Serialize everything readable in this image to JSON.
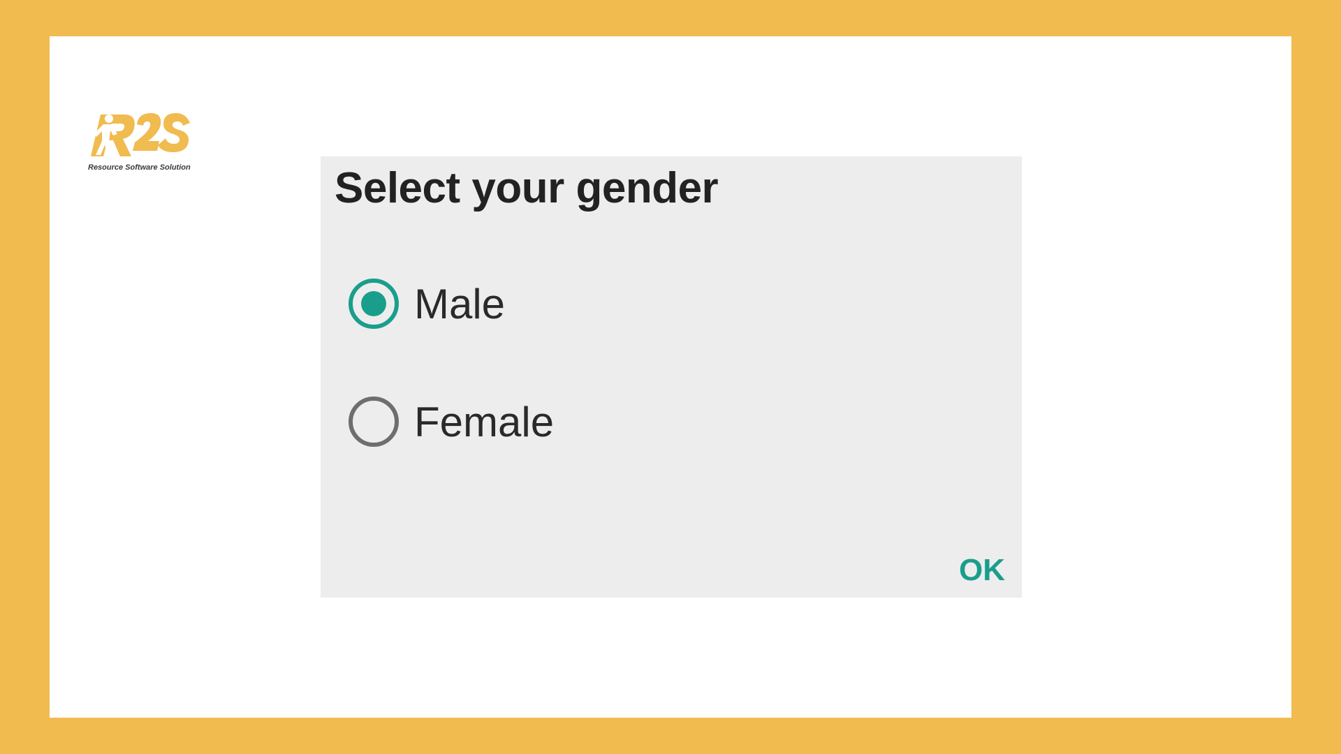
{
  "colors": {
    "background": "#F2BB4F",
    "card": "#FFFFFF",
    "dialog": "#EDEDED",
    "accent": "#1A9E8C",
    "logo": "#F0BB4F"
  },
  "logo": {
    "text": "R2S",
    "tagline": "Resource Software Solution"
  },
  "dialog": {
    "title": "Select your gender",
    "options": [
      {
        "label": "Male",
        "selected": true,
        "icon": "radio-checked-icon"
      },
      {
        "label": "Female",
        "selected": false,
        "icon": "radio-unchecked-icon"
      }
    ],
    "ok_label": "OK"
  }
}
